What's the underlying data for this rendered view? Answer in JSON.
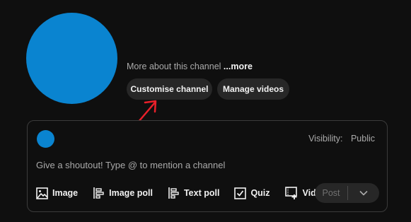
{
  "channel": {
    "about_text": "More about this channel",
    "more_link": "...more",
    "customise_label": "Customise channel",
    "manage_label": "Manage videos",
    "avatar_color": "#0a84d0"
  },
  "annotation": {
    "arrow_color": "#e8202a"
  },
  "post_composer": {
    "visibility_label": "Visibility:",
    "visibility_value": "Public",
    "placeholder": "Give a shoutout! Type @ to mention a channel",
    "actions": [
      {
        "label": "Image",
        "icon": "image-icon"
      },
      {
        "label": "Image poll",
        "icon": "image-poll-icon"
      },
      {
        "label": "Text poll",
        "icon": "text-poll-icon"
      },
      {
        "label": "Quiz",
        "icon": "quiz-checkbox-icon"
      },
      {
        "label": "Video",
        "icon": "video-add-icon"
      }
    ],
    "post_label": "Post"
  }
}
